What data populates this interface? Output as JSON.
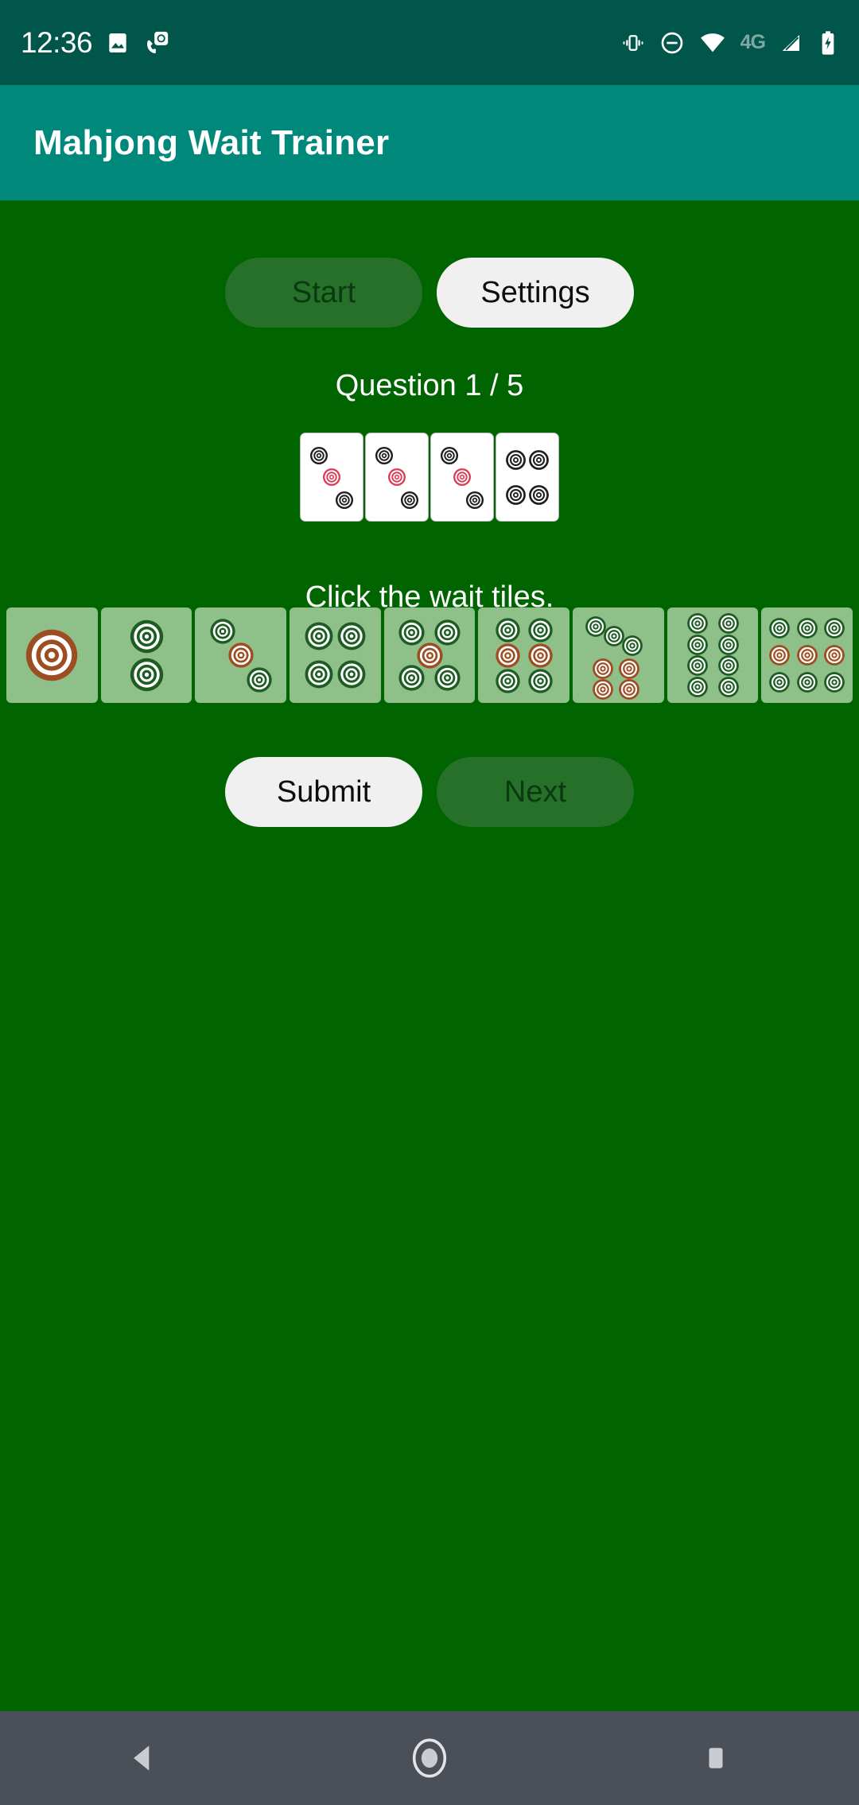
{
  "statusbar": {
    "time": "12:36",
    "network_label": "4G",
    "left_icons": [
      "image-icon",
      "screenshot-call-icon"
    ],
    "right_icons": [
      "vibrate-icon",
      "do-not-disturb-icon",
      "wifi-icon",
      "signal-icon",
      "battery-charging-icon"
    ],
    "background": "#00564a"
  },
  "appbar": {
    "title": "Mahjong Wait Trainer",
    "background": "#00897a"
  },
  "theme": {
    "page_background": "#006400",
    "tile_face": "#ffffff",
    "choice_tile": "#8fc08a",
    "button_enabled_bg": "#f0f0f0",
    "button_disabled_bg": "#26702a",
    "dot_dark": "#1f1f1f",
    "dot_red": "#d9405a",
    "choice_dot_dark": "#1d5c22",
    "choice_dot_red": "#9d4d22"
  },
  "toolbar": {
    "start_label": "Start",
    "start_enabled": false,
    "settings_label": "Settings",
    "settings_enabled": true
  },
  "quiz": {
    "question_label": "Question 1 / 5",
    "prompt": "Click the wait tiles.",
    "hand": [
      {
        "name": "3-dots-tile",
        "count": 3
      },
      {
        "name": "3-dots-tile",
        "count": 3
      },
      {
        "name": "3-dots-tile",
        "count": 3
      },
      {
        "name": "4-dots-tile",
        "count": 4
      }
    ],
    "choices": [
      {
        "name": "choice-tile-1-dot",
        "count": 1,
        "selected": false
      },
      {
        "name": "choice-tile-2-dots",
        "count": 2,
        "selected": false
      },
      {
        "name": "choice-tile-3-dots",
        "count": 3,
        "selected": false
      },
      {
        "name": "choice-tile-4-dots",
        "count": 4,
        "selected": false
      },
      {
        "name": "choice-tile-5-dots",
        "count": 5,
        "selected": false
      },
      {
        "name": "choice-tile-6-dots",
        "count": 6,
        "selected": false
      },
      {
        "name": "choice-tile-7-dots",
        "count": 7,
        "selected": false
      },
      {
        "name": "choice-tile-8-dots",
        "count": 8,
        "selected": false
      },
      {
        "name": "choice-tile-9-dots",
        "count": 9,
        "selected": false
      }
    ]
  },
  "actions": {
    "submit_label": "Submit",
    "submit_enabled": true,
    "next_label": "Next",
    "next_enabled": false
  },
  "navbar": {
    "back_label": "back-icon",
    "home_label": "home-icon",
    "recents_label": "recents-icon",
    "background": "#4b5058"
  }
}
